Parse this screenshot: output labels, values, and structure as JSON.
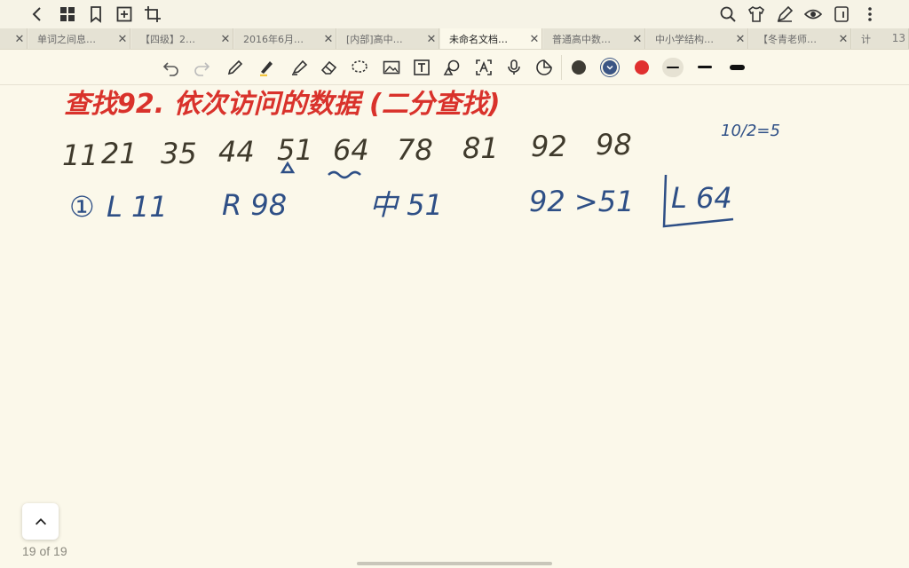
{
  "tabs": [
    {
      "label": "",
      "active": false
    },
    {
      "label": "单词之间息…",
      "active": false
    },
    {
      "label": "【四级】2…",
      "active": false
    },
    {
      "label": "2016年6月…",
      "active": false
    },
    {
      "label": "[内部]高中…",
      "active": false
    },
    {
      "label": "未命名文档…",
      "active": true
    },
    {
      "label": "普通高中数…",
      "active": false
    },
    {
      "label": "中小学结构…",
      "active": false
    },
    {
      "label": "【冬青老师…",
      "active": false
    },
    {
      "label": "计",
      "active": false
    }
  ],
  "tab_count": "13",
  "toolbar": {
    "colors": {
      "dark": "#3e3c35",
      "blue": "#3b5584",
      "red": "#e0302f"
    }
  },
  "notes": {
    "title": "查找92. 依次访问的数据 (二分查找)",
    "sequence": [
      "11",
      "21",
      "35",
      "44",
      "51",
      "64",
      "78",
      "81",
      "92",
      "98"
    ],
    "side_note": "10/2=5",
    "step_marker": "①",
    "left_label": "L 11",
    "right_label": "R 98",
    "mid_label": "中 51",
    "compare": "92 >51",
    "new_left": "L 64"
  },
  "pager": {
    "current": "19",
    "of": "of",
    "total": "19"
  }
}
